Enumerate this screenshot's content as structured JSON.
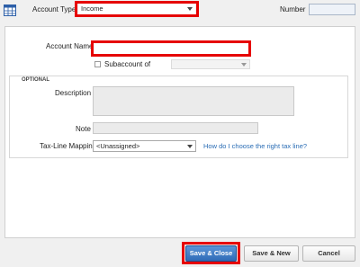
{
  "header": {
    "account_type_label": "Account Type",
    "account_type_value": "Income",
    "number_label": "Number",
    "number_value": ""
  },
  "form": {
    "account_name_label": "Account Name",
    "account_name_value": "",
    "subaccount_label": "Subaccount of",
    "subaccount_value": "",
    "optional_heading": "OPTIONAL",
    "description_label": "Description",
    "description_value": "",
    "note_label": "Note",
    "note_value": "",
    "tax_line_label": "Tax-Line Mapping",
    "tax_line_value": "<Unassigned>",
    "tax_line_help_link": "How do I choose the right tax line?"
  },
  "buttons": {
    "save_close": "Save & Close",
    "save_new": "Save & New",
    "cancel": "Cancel"
  },
  "colors": {
    "highlight": "#e60000",
    "link": "#2a6db5",
    "primary_button": "#2f6bb7"
  },
  "icons": {
    "account_type": "account-grid-icon",
    "dropdown": "chevron-down-icon"
  }
}
